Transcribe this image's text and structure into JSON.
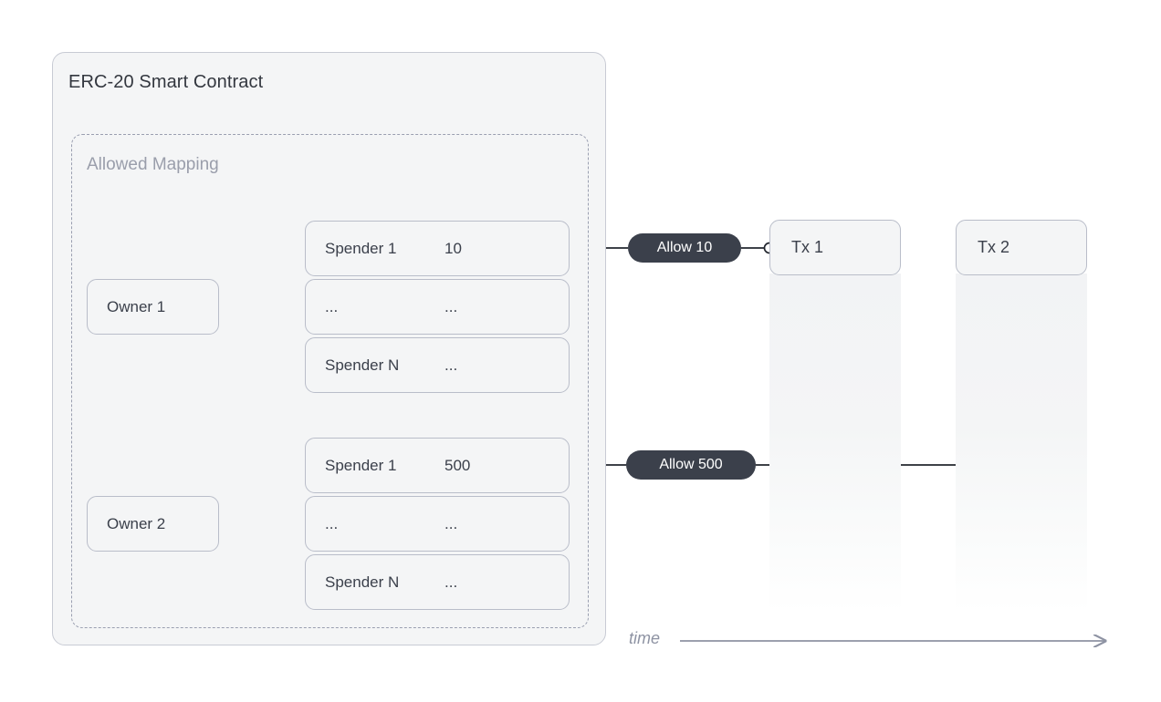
{
  "contract": {
    "title": "ERC-20 Smart Contract",
    "mapping_title": "Allowed Mapping",
    "owners": [
      {
        "name": "Owner 1",
        "rows": [
          {
            "spender": "Spender 1",
            "amount": "10"
          },
          {
            "spender": "...",
            "amount": "..."
          },
          {
            "spender": "Spender N",
            "amount": "..."
          }
        ]
      },
      {
        "name": "Owner 2",
        "rows": [
          {
            "spender": "Spender 1",
            "amount": "500"
          },
          {
            "spender": "...",
            "amount": "..."
          },
          {
            "spender": "Spender N",
            "amount": "..."
          }
        ]
      }
    ]
  },
  "actions": [
    {
      "label": "Allow 10"
    },
    {
      "label": "Allow 500"
    }
  ],
  "transactions": [
    {
      "label": "Tx 1"
    },
    {
      "label": "Tx 2"
    }
  ],
  "axis": {
    "label": "time"
  },
  "colors": {
    "panel_bg": "#f4f5f6",
    "panel_border": "#c8cbd4",
    "box_border": "#b9bdc9",
    "dashed_border": "#9a9fb0",
    "text": "#3b404b",
    "muted_text": "#9a9eab",
    "pill_bg": "#3b404b",
    "pill_text": "#ffffff",
    "connector": "#5a6070",
    "axis": "#8e93a3"
  }
}
